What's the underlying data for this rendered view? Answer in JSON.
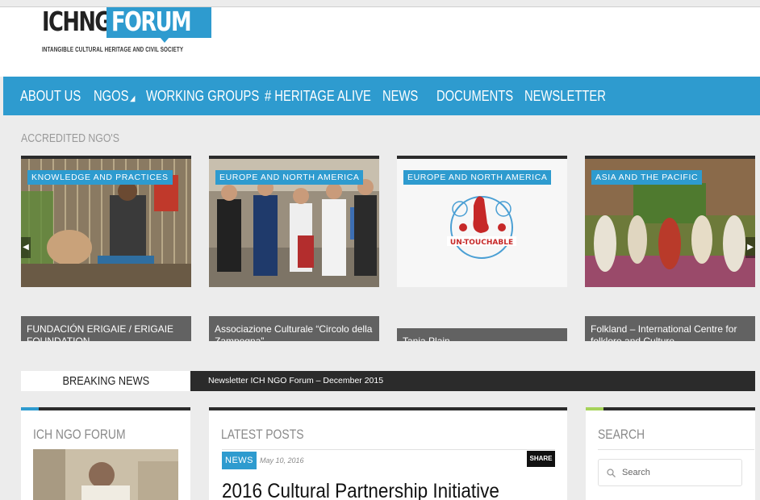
{
  "header": {
    "logo_part1": "ICHNGO",
    "logo_part2": "FORUM",
    "tagline": "INTANGIBLE CULTURAL HERITAGE AND CIVIL SOCIETY"
  },
  "nav": {
    "items": [
      {
        "label": "ABOUT US"
      },
      {
        "label": "NGOS"
      },
      {
        "label": "WORKING GROUPS"
      },
      {
        "label": "# HERITAGE ALIVE"
      },
      {
        "label": "NEWS"
      },
      {
        "label": "DOCUMENTS"
      },
      {
        "label": "NEWSLETTER"
      }
    ],
    "ngos_caret": "◢"
  },
  "accredited": {
    "title": "ACCREDITED NGO'S",
    "cards": [
      {
        "tag": "KNOWLEDGE AND PRACTICES",
        "title": "FUNDACIÓN ERIGAIE / ERIGAIE FOUNDATION"
      },
      {
        "tag": "EUROPE AND NORTH AMERICA",
        "title": "Associazione Culturale “Circolo della Zampogna”"
      },
      {
        "tag": "EUROPE AND NORTH AMERICA",
        "title": "Tanja Plain"
      },
      {
        "tag": "ASIA AND THE PACIFIC",
        "title": "Folkland – International Centre for folklore and Culture"
      }
    ],
    "logo_text": "UN-TOUCHABLE"
  },
  "breaking": {
    "label": "BREAKING NEWS",
    "ticker": "Newsletter ICH NGO Forum – December 2015"
  },
  "panels": {
    "forum_title": "ICH NGO FORUM",
    "latest_title": "LATEST POSTS",
    "news_badge": "NEWS",
    "post_date": "May 10, 2016",
    "share_label": "SHARE",
    "post_title": "2016 Cultural Partnership Initiative",
    "search_title": "SEARCH",
    "search_placeholder": "Search"
  },
  "colors": {
    "brand_blue": "#2e9bcf",
    "dark": "#2b2b2b",
    "accent_green": "#a6d35a"
  }
}
